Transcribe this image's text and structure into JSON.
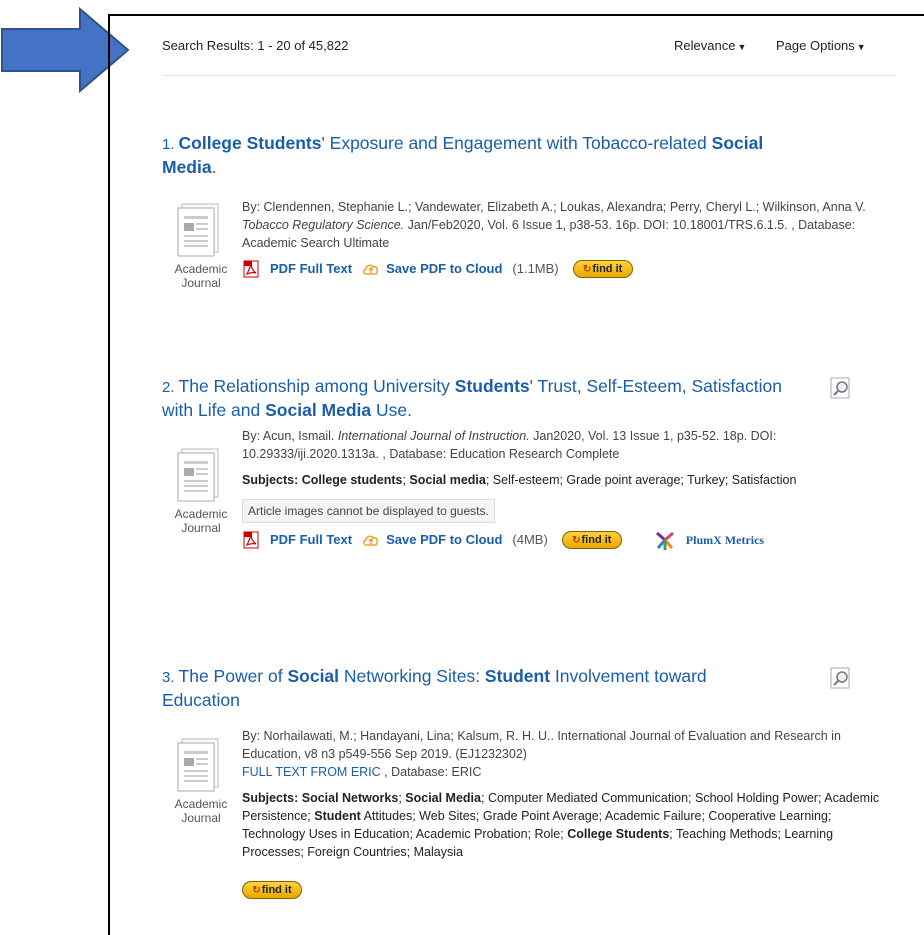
{
  "topbar": {
    "results_label": "Search Results: 1 - 20 of 45,822",
    "sort_label": "Relevance",
    "page_options_label": "Page Options"
  },
  "icons": {
    "annotation": "blue-arrow-icon",
    "document": "document-icon",
    "pdf": "pdf-icon",
    "cloud": "cloud-upload-icon",
    "preview": "magnifier-preview-icon",
    "plumx": "plumx-icon",
    "findit": "findit-icon"
  },
  "colors": {
    "link": "#1a5eaa",
    "arrow": "#4472c4",
    "findit": "#ffd23a",
    "plumx": "#7b2a8f"
  },
  "results": [
    {
      "num": "1.",
      "title": [
        {
          "t": "College Students",
          "b": true
        },
        {
          "t": "' Exposure and Engagement with Tobacco-related ",
          "b": false
        },
        {
          "t": "Social Media",
          "b": true
        },
        {
          "t": ".",
          "b": false
        }
      ],
      "type_label_1": "Academic",
      "type_label_2": "Journal",
      "byline": [
        {
          "t": "By: Clendennen, Stephanie L.; Vandewater, Elizabeth A.; Loukas, Alexandra; Perry, Cheryl L.; Wilkinson, Anna V. ",
          "i": false
        },
        {
          "t": "Tobacco Regulatory Science.",
          "i": true
        },
        {
          "t": " Jan/Feb2020, Vol. 6 Issue 1, p38-53. 16p. DOI: 10.18001/TRS.6.1.5. , Database: Academic Search Ultimate",
          "i": false
        }
      ],
      "pdf_label": "PDF Full Text",
      "cloud_label": "Save PDF to Cloud",
      "size": "(1.1MB)",
      "findit_label": "find it"
    },
    {
      "num": "2.",
      "title": [
        {
          "t": "The Relationship among University ",
          "b": false
        },
        {
          "t": "Students",
          "b": true
        },
        {
          "t": "' Trust, Self-Esteem, Satisfaction with Life and ",
          "b": false
        },
        {
          "t": "Social Media",
          "b": true
        },
        {
          "t": " Use.",
          "b": false
        }
      ],
      "type_label_1": "Academic",
      "type_label_2": "Journal",
      "byline": [
        {
          "t": "By: Acun, Ismail. ",
          "i": false
        },
        {
          "t": "International Journal of Instruction.",
          "i": true
        },
        {
          "t": " Jan2020, Vol. 13 Issue 1, p35-52. 18p. DOI: 10.29333/iji.2020.1313a. , Database: Education Research Complete",
          "i": false
        }
      ],
      "subjects": [
        {
          "t": "Subjects: College students",
          "b": true
        },
        {
          "t": "; ",
          "b": false
        },
        {
          "t": "Social media",
          "b": true
        },
        {
          "t": "; Self-esteem; Grade point average; Turkey; Satisfaction",
          "b": false
        }
      ],
      "guest_note": "Article images cannot be displayed to guests.",
      "pdf_label": "PDF Full Text",
      "cloud_label": "Save PDF to Cloud",
      "size": "(4MB)",
      "findit_label": "find it",
      "plumx_label": "PlumX Metrics"
    },
    {
      "num": "3.",
      "title": [
        {
          "t": "The Power of ",
          "b": false
        },
        {
          "t": "Social",
          "b": true
        },
        {
          "t": " Networking Sites: ",
          "b": false
        },
        {
          "t": "Student",
          "b": true
        },
        {
          "t": " Involvement toward Education",
          "b": false
        }
      ],
      "type_label_1": "Academic",
      "type_label_2": "Journal",
      "byline_plain": "By: Norhailawati, M.; Handayani, Lina; Kalsum, R. H. U.. International Journal of Evaluation and Research in Education, v8 n3 p549-556 Sep 2019. (EJ1232302)",
      "eric_link": "FULL TEXT FROM ERIC",
      "database": " , Database: ERIC",
      "subjects": [
        {
          "t": "Subjects: Social Networks",
          "b": true
        },
        {
          "t": "; ",
          "b": false
        },
        {
          "t": "Social Media",
          "b": true
        },
        {
          "t": "; Computer Mediated Communication; School Holding Power; Academic Persistence; ",
          "b": false
        },
        {
          "t": "Student",
          "b": true
        },
        {
          "t": " Attitudes; Web Sites; Grade Point Average; Academic Failure; Cooperative Learning; Technology Uses in Education; Academic Probation; Role; ",
          "b": false
        },
        {
          "t": "College Students",
          "b": true
        },
        {
          "t": "; Teaching Methods; Learning Processes; Foreign Countries; Malaysia",
          "b": false
        }
      ],
      "findit_label": "find it"
    }
  ]
}
